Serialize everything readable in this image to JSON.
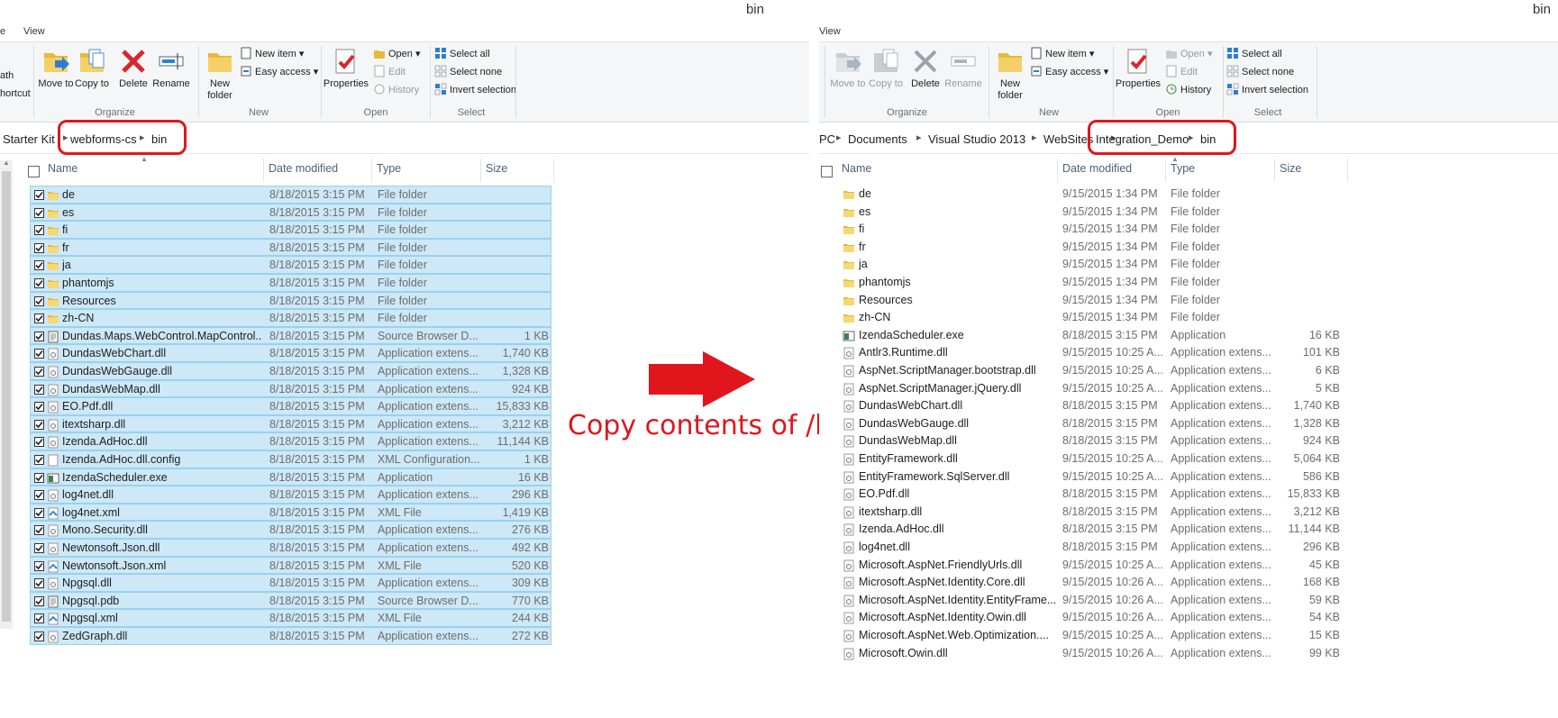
{
  "left": {
    "title": "bin",
    "menu": [
      "e",
      "View"
    ],
    "ribbon": {
      "clip_items": [
        "ath",
        "hortcut"
      ],
      "organize": {
        "move_to": "Move to",
        "copy_to": "Copy to",
        "delete": "Delete",
        "rename": "Rename",
        "label": "Organize"
      },
      "new": {
        "new_folder": "New folder",
        "new_item": "New item",
        "easy_access": "Easy access",
        "label": "New"
      },
      "open": {
        "properties": "Properties",
        "open": "Open",
        "edit": "Edit",
        "history": "History",
        "label": "Open"
      },
      "select": {
        "select_all": "Select all",
        "select_none": "Select none",
        "invert": "Invert selection",
        "label": "Select"
      }
    },
    "breadcrumb": [
      "Starter Kit",
      "webforms-cs",
      "bin"
    ],
    "columns": {
      "name": "Name",
      "date": "Date modified",
      "type": "Type",
      "size": "Size"
    },
    "files": [
      {
        "name": "de",
        "date": "8/18/2015 3:15 PM",
        "type": "File folder",
        "size": "",
        "icon": "folder-icon"
      },
      {
        "name": "es",
        "date": "8/18/2015 3:15 PM",
        "type": "File folder",
        "size": "",
        "icon": "folder-icon"
      },
      {
        "name": "fi",
        "date": "8/18/2015 3:15 PM",
        "type": "File folder",
        "size": "",
        "icon": "folder-icon"
      },
      {
        "name": "fr",
        "date": "8/18/2015 3:15 PM",
        "type": "File folder",
        "size": "",
        "icon": "folder-icon"
      },
      {
        "name": "ja",
        "date": "8/18/2015 3:15 PM",
        "type": "File folder",
        "size": "",
        "icon": "folder-icon"
      },
      {
        "name": "phantomjs",
        "date": "8/18/2015 3:15 PM",
        "type": "File folder",
        "size": "",
        "icon": "folder-icon"
      },
      {
        "name": "Resources",
        "date": "8/18/2015 3:15 PM",
        "type": "File folder",
        "size": "",
        "icon": "folder-icon"
      },
      {
        "name": "zh-CN",
        "date": "8/18/2015 3:15 PM",
        "type": "File folder",
        "size": "",
        "icon": "folder-icon"
      },
      {
        "name": "Dundas.Maps.WebControl.MapControl...",
        "date": "8/18/2015 3:15 PM",
        "type": "Source Browser D...",
        "size": "1 KB",
        "icon": "document-icon"
      },
      {
        "name": "DundasWebChart.dll",
        "date": "8/18/2015 3:15 PM",
        "type": "Application extens...",
        "size": "1,740 KB",
        "icon": "dll-icon"
      },
      {
        "name": "DundasWebGauge.dll",
        "date": "8/18/2015 3:15 PM",
        "type": "Application extens...",
        "size": "1,328 KB",
        "icon": "dll-icon"
      },
      {
        "name": "DundasWebMap.dll",
        "date": "8/18/2015 3:15 PM",
        "type": "Application extens...",
        "size": "924 KB",
        "icon": "dll-icon"
      },
      {
        "name": "EO.Pdf.dll",
        "date": "8/18/2015 3:15 PM",
        "type": "Application extens...",
        "size": "15,833 KB",
        "icon": "dll-icon"
      },
      {
        "name": "itextsharp.dll",
        "date": "8/18/2015 3:15 PM",
        "type": "Application extens...",
        "size": "3,212 KB",
        "icon": "dll-icon"
      },
      {
        "name": "Izenda.AdHoc.dll",
        "date": "8/18/2015 3:15 PM",
        "type": "Application extens...",
        "size": "11,144 KB",
        "icon": "dll-icon"
      },
      {
        "name": "Izenda.AdHoc.dll.config",
        "date": "8/18/2015 3:15 PM",
        "type": "XML Configuration...",
        "size": "1 KB",
        "icon": "blank-file-icon"
      },
      {
        "name": "IzendaScheduler.exe",
        "date": "8/18/2015 3:15 PM",
        "type": "Application",
        "size": "16 KB",
        "icon": "exe-icon"
      },
      {
        "name": "log4net.dll",
        "date": "8/18/2015 3:15 PM",
        "type": "Application extens...",
        "size": "296 KB",
        "icon": "dll-icon"
      },
      {
        "name": "log4net.xml",
        "date": "8/18/2015 3:15 PM",
        "type": "XML File",
        "size": "1,419 KB",
        "icon": "xml-icon"
      },
      {
        "name": "Mono.Security.dll",
        "date": "8/18/2015 3:15 PM",
        "type": "Application extens...",
        "size": "276 KB",
        "icon": "dll-icon"
      },
      {
        "name": "Newtonsoft.Json.dll",
        "date": "8/18/2015 3:15 PM",
        "type": "Application extens...",
        "size": "492 KB",
        "icon": "dll-icon"
      },
      {
        "name": "Newtonsoft.Json.xml",
        "date": "8/18/2015 3:15 PM",
        "type": "XML File",
        "size": "520 KB",
        "icon": "xml-icon"
      },
      {
        "name": "Npgsql.dll",
        "date": "8/18/2015 3:15 PM",
        "type": "Application extens...",
        "size": "309 KB",
        "icon": "dll-icon"
      },
      {
        "name": "Npgsql.pdb",
        "date": "8/18/2015 3:15 PM",
        "type": "Source Browser D...",
        "size": "770 KB",
        "icon": "document-icon"
      },
      {
        "name": "Npgsql.xml",
        "date": "8/18/2015 3:15 PM",
        "type": "XML File",
        "size": "244 KB",
        "icon": "xml-icon"
      },
      {
        "name": "ZedGraph.dll",
        "date": "8/18/2015 3:15 PM",
        "type": "Application extens...",
        "size": "272 KB",
        "icon": "dll-icon"
      }
    ]
  },
  "right": {
    "title": "bin",
    "menu": [
      "View"
    ],
    "ribbon": {
      "organize": {
        "move_to": "Move to",
        "copy_to": "Copy to",
        "delete": "Delete",
        "rename": "Rename",
        "label": "Organize"
      },
      "new": {
        "new_folder": "New folder",
        "new_item": "New item",
        "easy_access": "Easy access",
        "label": "New"
      },
      "open": {
        "properties": "Properties",
        "open": "Open",
        "edit": "Edit",
        "history": "History",
        "label": "Open"
      },
      "select": {
        "select_all": "Select all",
        "select_none": "Select none",
        "invert": "Invert selection",
        "label": "Select"
      }
    },
    "breadcrumb": [
      "PC",
      "Documents",
      "Visual Studio 2013",
      "WebSites",
      "Integration_Demo",
      "bin"
    ],
    "columns": {
      "name": "Name",
      "date": "Date modified",
      "type": "Type",
      "size": "Size"
    },
    "files": [
      {
        "name": "de",
        "date": "9/15/2015 1:34 PM",
        "type": "File folder",
        "size": "",
        "icon": "folder-icon"
      },
      {
        "name": "es",
        "date": "9/15/2015 1:34 PM",
        "type": "File folder",
        "size": "",
        "icon": "folder-icon"
      },
      {
        "name": "fi",
        "date": "9/15/2015 1:34 PM",
        "type": "File folder",
        "size": "",
        "icon": "folder-icon"
      },
      {
        "name": "fr",
        "date": "9/15/2015 1:34 PM",
        "type": "File folder",
        "size": "",
        "icon": "folder-icon"
      },
      {
        "name": "ja",
        "date": "9/15/2015 1:34 PM",
        "type": "File folder",
        "size": "",
        "icon": "folder-icon"
      },
      {
        "name": "phantomjs",
        "date": "9/15/2015 1:34 PM",
        "type": "File folder",
        "size": "",
        "icon": "folder-icon"
      },
      {
        "name": "Resources",
        "date": "9/15/2015 1:34 PM",
        "type": "File folder",
        "size": "",
        "icon": "folder-icon"
      },
      {
        "name": "zh-CN",
        "date": "9/15/2015 1:34 PM",
        "type": "File folder",
        "size": "",
        "icon": "folder-icon"
      },
      {
        "name": "IzendaScheduler.exe",
        "date": "8/18/2015 3:15 PM",
        "type": "Application",
        "size": "16 KB",
        "icon": "exe-icon"
      },
      {
        "name": "Antlr3.Runtime.dll",
        "date": "9/15/2015 10:25 A...",
        "type": "Application extens...",
        "size": "101 KB",
        "icon": "dll-icon"
      },
      {
        "name": "AspNet.ScriptManager.bootstrap.dll",
        "date": "9/15/2015 10:25 A...",
        "type": "Application extens...",
        "size": "6 KB",
        "icon": "dll-icon"
      },
      {
        "name": "AspNet.ScriptManager.jQuery.dll",
        "date": "9/15/2015 10:25 A...",
        "type": "Application extens...",
        "size": "5 KB",
        "icon": "dll-icon"
      },
      {
        "name": "DundasWebChart.dll",
        "date": "8/18/2015 3:15 PM",
        "type": "Application extens...",
        "size": "1,740 KB",
        "icon": "dll-icon"
      },
      {
        "name": "DundasWebGauge.dll",
        "date": "8/18/2015 3:15 PM",
        "type": "Application extens...",
        "size": "1,328 KB",
        "icon": "dll-icon"
      },
      {
        "name": "DundasWebMap.dll",
        "date": "8/18/2015 3:15 PM",
        "type": "Application extens...",
        "size": "924 KB",
        "icon": "dll-icon"
      },
      {
        "name": "EntityFramework.dll",
        "date": "9/15/2015 10:25 A...",
        "type": "Application extens...",
        "size": "5,064 KB",
        "icon": "dll-icon"
      },
      {
        "name": "EntityFramework.SqlServer.dll",
        "date": "9/15/2015 10:25 A...",
        "type": "Application extens...",
        "size": "586 KB",
        "icon": "dll-icon"
      },
      {
        "name": "EO.Pdf.dll",
        "date": "8/18/2015 3:15 PM",
        "type": "Application extens...",
        "size": "15,833 KB",
        "icon": "dll-icon"
      },
      {
        "name": "itextsharp.dll",
        "date": "8/18/2015 3:15 PM",
        "type": "Application extens...",
        "size": "3,212 KB",
        "icon": "dll-icon"
      },
      {
        "name": "Izenda.AdHoc.dll",
        "date": "8/18/2015 3:15 PM",
        "type": "Application extens...",
        "size": "11,144 KB",
        "icon": "dll-icon"
      },
      {
        "name": "log4net.dll",
        "date": "8/18/2015 3:15 PM",
        "type": "Application extens...",
        "size": "296 KB",
        "icon": "dll-icon"
      },
      {
        "name": "Microsoft.AspNet.FriendlyUrls.dll",
        "date": "9/15/2015 10:25 A...",
        "type": "Application extens...",
        "size": "45 KB",
        "icon": "dll-icon"
      },
      {
        "name": "Microsoft.AspNet.Identity.Core.dll",
        "date": "9/15/2015 10:26 A...",
        "type": "Application extens...",
        "size": "168 KB",
        "icon": "dll-icon"
      },
      {
        "name": "Microsoft.AspNet.Identity.EntityFrame...",
        "date": "9/15/2015 10:26 A...",
        "type": "Application extens...",
        "size": "59 KB",
        "icon": "dll-icon"
      },
      {
        "name": "Microsoft.AspNet.Identity.Owin.dll",
        "date": "9/15/2015 10:26 A...",
        "type": "Application extens...",
        "size": "54 KB",
        "icon": "dll-icon"
      },
      {
        "name": "Microsoft.AspNet.Web.Optimization....",
        "date": "9/15/2015 10:25 A...",
        "type": "Application extens...",
        "size": "15 KB",
        "icon": "dll-icon"
      },
      {
        "name": "Microsoft.Owin.dll",
        "date": "9/15/2015 10:26 A...",
        "type": "Application extens...",
        "size": "99 KB",
        "icon": "dll-icon"
      }
    ]
  },
  "annotation": {
    "caption": "Copy contents of /bin",
    "color": "#e0161c"
  }
}
